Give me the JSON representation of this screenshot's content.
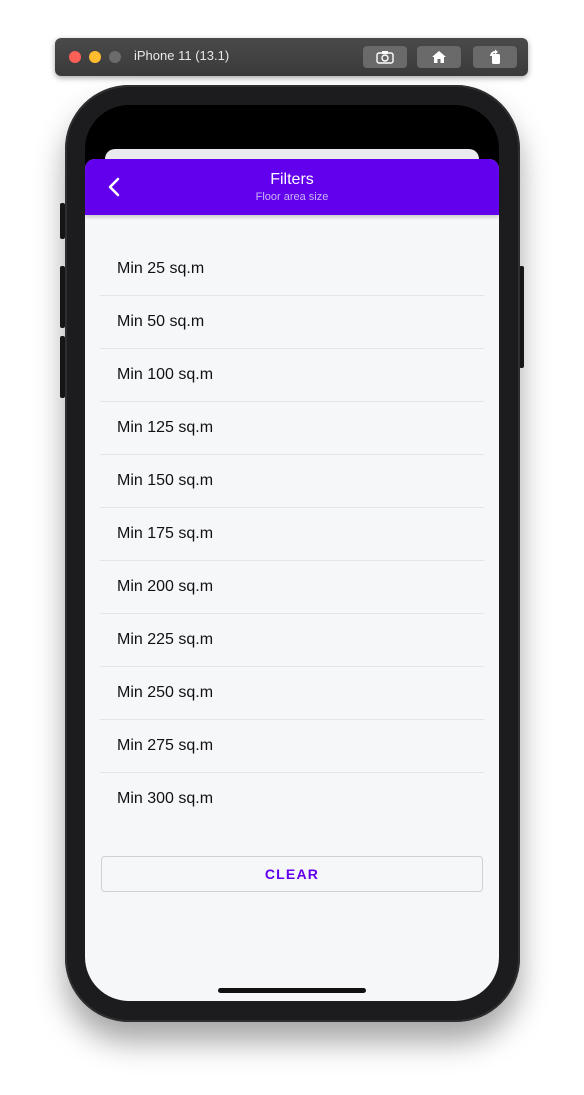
{
  "simulator": {
    "title": "iPhone 11 (13.1)",
    "buttons": [
      "screenshot-icon",
      "home-icon",
      "rotate-icon"
    ]
  },
  "header": {
    "title": "Filters",
    "subtitle": "Floor area size",
    "back_icon": "chevron-left-icon",
    "background": "#6200ee"
  },
  "options": [
    {
      "label": "Min 25 sq.m"
    },
    {
      "label": "Min 50 sq.m"
    },
    {
      "label": "Min 100 sq.m"
    },
    {
      "label": "Min 125 sq.m"
    },
    {
      "label": "Min 150 sq.m"
    },
    {
      "label": "Min 175 sq.m"
    },
    {
      "label": "Min 200 sq.m"
    },
    {
      "label": "Min 225 sq.m"
    },
    {
      "label": "Min 250 sq.m"
    },
    {
      "label": "Min 275 sq.m"
    },
    {
      "label": "Min 300 sq.m"
    }
  ],
  "clear_button": {
    "label": "CLEAR",
    "color": "#6200ee"
  }
}
